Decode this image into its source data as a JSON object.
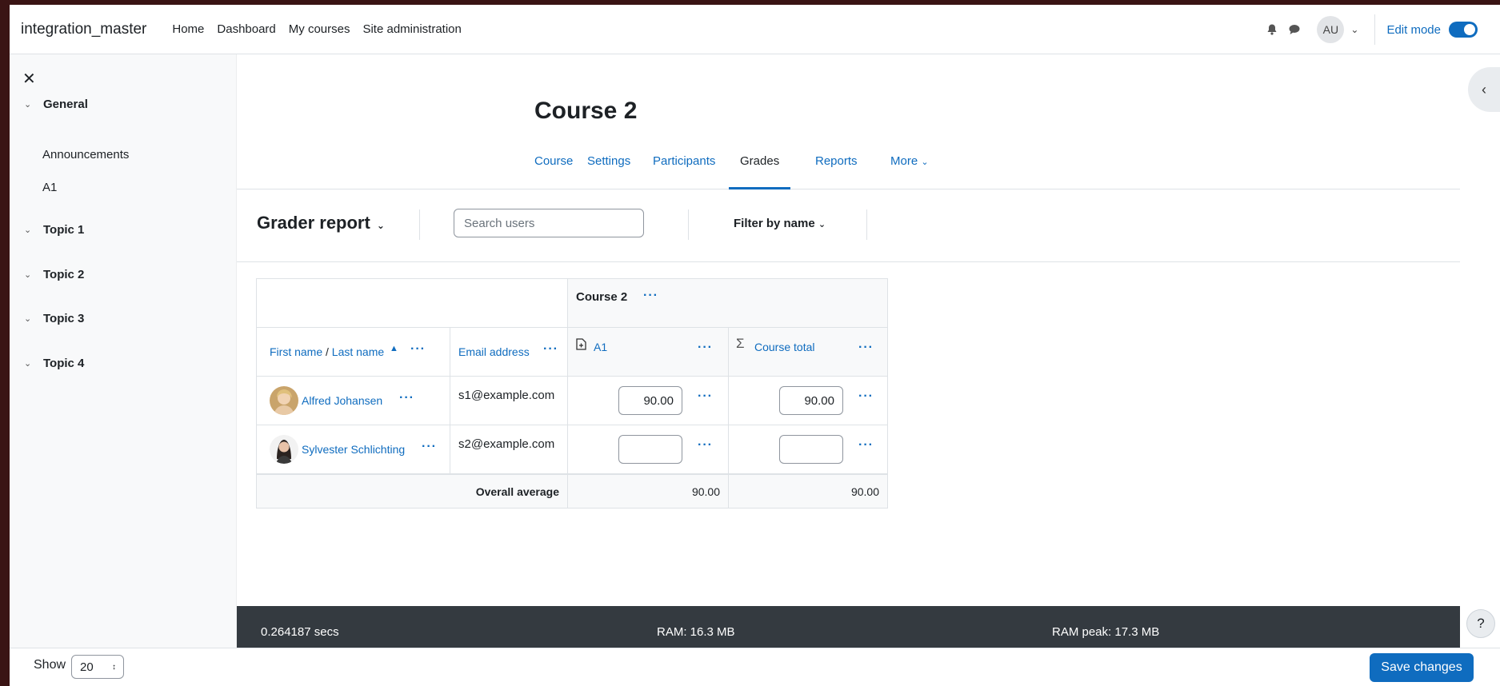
{
  "navbar": {
    "brand": "integration_master",
    "links": [
      "Home",
      "Dashboard",
      "My courses",
      "Site administration"
    ],
    "avatar_initials": "AU",
    "edit_mode_label": "Edit mode"
  },
  "drawer": {
    "sections": [
      {
        "label": "General",
        "items": [
          "Announcements",
          "A1"
        ]
      },
      {
        "label": "Topic 1"
      },
      {
        "label": "Topic 2"
      },
      {
        "label": "Topic 3"
      },
      {
        "label": "Topic 4"
      }
    ]
  },
  "page": {
    "title": "Course 2",
    "tabs": [
      "Course",
      "Settings",
      "Participants",
      "Grades",
      "Reports",
      "More"
    ],
    "active_tab": "Grades"
  },
  "toolbar": {
    "report_title": "Grader report",
    "search_placeholder": "Search users",
    "filter_label": "Filter by name"
  },
  "grader": {
    "category_header": "Course 2",
    "col_firstname": "First name",
    "col_sep": "/",
    "col_lastname": "Last name",
    "col_email": "Email address",
    "col_a1": "A1",
    "col_total": "Course total",
    "rows": [
      {
        "name": "Alfred Johansen",
        "email": "s1@example.com",
        "a1": "90.00",
        "total": "90.00"
      },
      {
        "name": "Sylvester Schlichting",
        "email": "s2@example.com",
        "a1": "",
        "total": ""
      }
    ],
    "average_label": "Overall average",
    "average_a1": "90.00",
    "average_total": "90.00"
  },
  "footer": {
    "time": "0.264187 secs",
    "ram": "RAM: 16.3 MB",
    "ram_peak": "RAM peak: 17.3 MB"
  },
  "bottom": {
    "show_label": "Show",
    "show_value": "20",
    "save_label": "Save changes"
  },
  "colors": {
    "link": "#0f6cbf",
    "footer_bg": "#343a40",
    "drawer_bg": "#f8f9fa"
  }
}
